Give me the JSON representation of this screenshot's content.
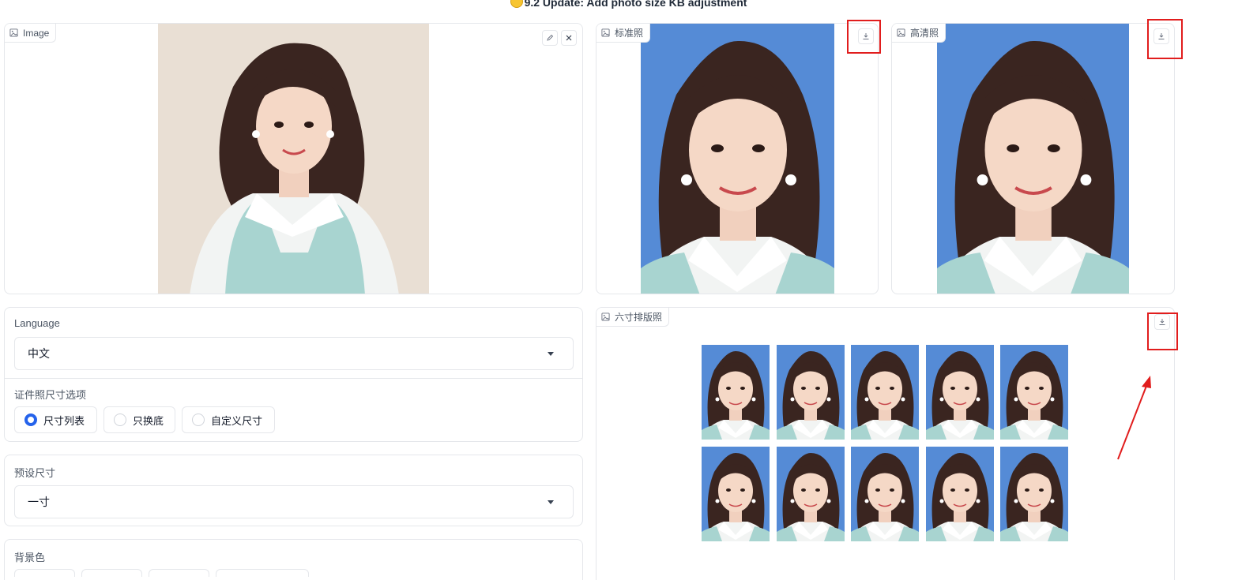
{
  "banner": {
    "icon": "smiley-emoji",
    "text": "9.2 Update: Add photo size KB adjustment"
  },
  "input_image": {
    "label": "Image",
    "icon": "image-icon",
    "edit_icon": "pencil-icon",
    "clear_icon": "close-icon"
  },
  "outputs": {
    "standard": {
      "label": "标准照",
      "icon": "image-icon",
      "download_icon": "download-icon"
    },
    "hd": {
      "label": "高清照",
      "icon": "image-icon",
      "download_icon": "download-icon"
    },
    "layout": {
      "label": "六寸排版照",
      "icon": "image-icon",
      "download_icon": "download-icon",
      "count": 10
    }
  },
  "settings": {
    "language": {
      "label": "Language",
      "value": "中文"
    },
    "size_mode": {
      "label": "证件照尺寸选项",
      "options": [
        "尺寸列表",
        "只换底",
        "自定义尺寸"
      ],
      "selected": "尺寸列表"
    },
    "preset": {
      "label": "预设尺寸",
      "value": "一寸"
    },
    "background": {
      "label": "背景色"
    }
  },
  "colors": {
    "photo_bg_blue": "#558bd6",
    "input_bg": "#e9dfd4",
    "accent": "#2563eb",
    "highlight": "#e11d1d"
  }
}
